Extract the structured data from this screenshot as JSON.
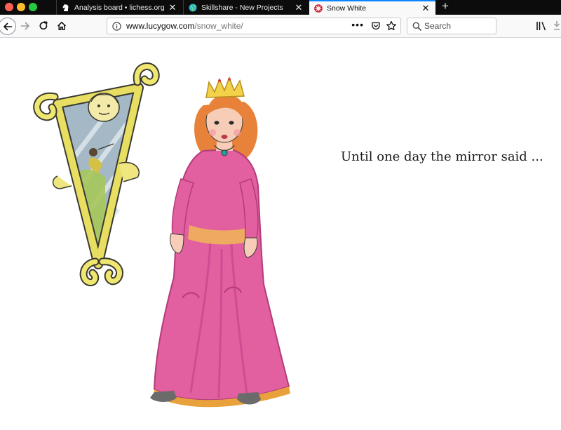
{
  "tabs": [
    {
      "title": "Analysis board • lichess.org",
      "close": "✕",
      "active": false
    },
    {
      "title": "Skillshare - New Projects",
      "close": "✕",
      "active": false
    },
    {
      "title": "Snow White",
      "close": "✕",
      "active": true
    }
  ],
  "newtab_label": "+",
  "urlbar": {
    "host": "www.lucygow.com",
    "path": "/snow_white/",
    "more": "•••"
  },
  "search": {
    "placeholder": "Search",
    "value": ""
  },
  "page": {
    "story_text": "Until one day the mirror said ..."
  },
  "icons": {
    "tab1": "knight-favicon",
    "tab2": "globe-favicon",
    "tab3": "flower-favicon",
    "back": "arrow-left-icon",
    "forward": "arrow-right-icon",
    "reload": "reload-icon",
    "home": "home-icon",
    "info": "info-icon",
    "pocket": "pocket-icon",
    "star": "star-icon",
    "search": "search-icon",
    "library": "library-icon",
    "download": "download-icon"
  },
  "colors": {
    "tabstrip": "#0c0c0d",
    "active_tab": "#f9f9fa",
    "accent": "#0a84ff",
    "dress": "#e25fa0",
    "mirror_frame": "#e8df62"
  }
}
